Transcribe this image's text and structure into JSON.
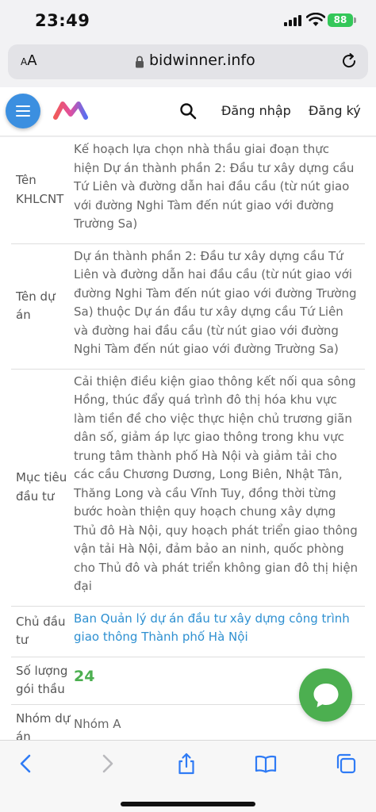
{
  "status_bar": {
    "time": "23:49",
    "battery": "88"
  },
  "browser": {
    "text_size_label_small": "A",
    "text_size_label_large": "A",
    "url": "bidwinner.info"
  },
  "header": {
    "login": "Đăng nhập",
    "register": "Đăng ký"
  },
  "rows": [
    {
      "label": "Tên KHLCNT",
      "value": "Kế hoạch lựa chọn nhà thầu giai đoạn thực hiện Dự án thành phần 2: Đầu tư xây dựng cầu Tứ Liên và đường dẫn hai đầu cầu (từ nút giao với đường Nghi Tàm đến nút giao với đường Trường Sa)"
    },
    {
      "label": "Tên dự án",
      "value": "Dự án thành phần 2: Đầu tư xây dựng cầu Tứ Liên và đường dẫn hai đầu cầu (từ nút giao với đường Nghi Tàm đến nút giao với đường Trường Sa) thuộc Dự án đầu tư xây dựng cầu Tứ Liên và đường hai đầu cầu (từ nút giao với đường Nghi Tàm đến nút giao với đường Trường Sa)"
    },
    {
      "label": "Mục tiêu đầu tư",
      "value": "Cải thiện điều kiện giao thông kết nối qua sông Hồng, thúc đẩy quá trình đô thị hóa khu vực làm tiền đề cho việc thực hiện chủ trương giãn dân số, giảm áp lực giao thông trong khu vực trung tâm thành phố Hà Nội và giảm tải cho các cầu Chương Dương, Long Biên, Nhật Tân, Thăng Long và cầu Vĩnh Tuy, đồng thời từng bước hoàn thiện quy hoạch chung xây dựng Thủ đô Hà Nội, quy hoạch phát triển giao thông vận tải Hà Nội, đảm bảo an ninh, quốc phòng cho Thủ đô và phát triển không gian đô thị hiện đại"
    },
    {
      "label": "Chủ đầu tư",
      "value": "Ban Quản lý dự án đầu tư xây dựng công trình giao thông Thành phố Hà Nội"
    },
    {
      "label": "Số lượng gói thầu",
      "value": "24"
    },
    {
      "label": "Nhóm dự án",
      "value": "Nhóm A"
    }
  ],
  "colors": {
    "accent": "#3b8fe0",
    "link": "#2e90d1",
    "success": "#4caf50",
    "chat_fab": "#4caf50"
  },
  "icons": [
    "menu-icon",
    "logo-icon",
    "search-icon",
    "chat-icon",
    "back-icon",
    "forward-icon",
    "share-icon",
    "bookmarks-icon",
    "tabs-icon",
    "lock-icon",
    "reload-icon"
  ]
}
